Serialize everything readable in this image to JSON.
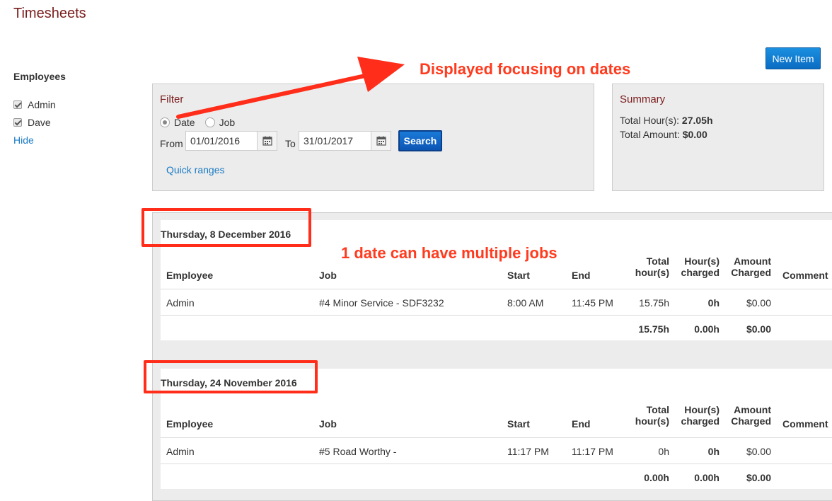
{
  "page": {
    "title": "Timesheets"
  },
  "toolbar": {
    "new_item_label": "New Item"
  },
  "sidebar": {
    "title": "Employees",
    "employees": [
      {
        "name": "Admin",
        "checked": true
      },
      {
        "name": "Dave",
        "checked": true
      }
    ],
    "hide_label": "Hide"
  },
  "filter": {
    "title": "Filter",
    "mode_options": [
      {
        "label": "Date",
        "selected": true
      },
      {
        "label": "Job",
        "selected": false
      }
    ],
    "from_label": "From",
    "from_value": "01/01/2016",
    "to_label": "To",
    "to_value": "31/01/2017",
    "search_label": "Search",
    "quick_ranges_label": "Quick ranges"
  },
  "summary": {
    "title": "Summary",
    "total_hours_label": "Total Hour(s):",
    "total_hours_value": "27.05h",
    "total_amount_label": "Total Amount:",
    "total_amount_value": "$0.00"
  },
  "table_headers": {
    "employee": "Employee",
    "job": "Job",
    "start": "Start",
    "end": "End",
    "total_hours_1": "Total",
    "total_hours_2": "hour(s)",
    "hours_charged_1": "Hour(s)",
    "hours_charged_2": "charged",
    "amount_charged_1": "Amount",
    "amount_charged_2": "Charged",
    "comment": "Comment"
  },
  "days": [
    {
      "title": "Thursday, 8 December 2016",
      "entries": [
        {
          "employee": "Admin",
          "job": "#4 Minor Service - SDF3232",
          "start": "8:00 AM",
          "end": "11:45 PM",
          "total_hours": "15.75h",
          "hours_charged": "0h",
          "amount_charged": "$0.00",
          "comment": ""
        }
      ],
      "totals": {
        "total_hours": "15.75h",
        "hours_charged": "0.00h",
        "amount_charged": "$0.00"
      }
    },
    {
      "title": "Thursday, 24 November 2016",
      "entries": [
        {
          "employee": "Admin",
          "job": "#5 Road Worthy -",
          "start": "11:17 PM",
          "end": "11:17 PM",
          "total_hours": "0h",
          "hours_charged": "0h",
          "amount_charged": "$0.00",
          "comment": ""
        }
      ],
      "totals": {
        "total_hours": "0.00h",
        "hours_charged": "0.00h",
        "amount_charged": "$0.00"
      }
    }
  ],
  "annotations": {
    "arrow_note": "Displayed focusing on dates",
    "jobs_note": "1 date can have multiple jobs",
    "color": "#ff3b1f"
  }
}
